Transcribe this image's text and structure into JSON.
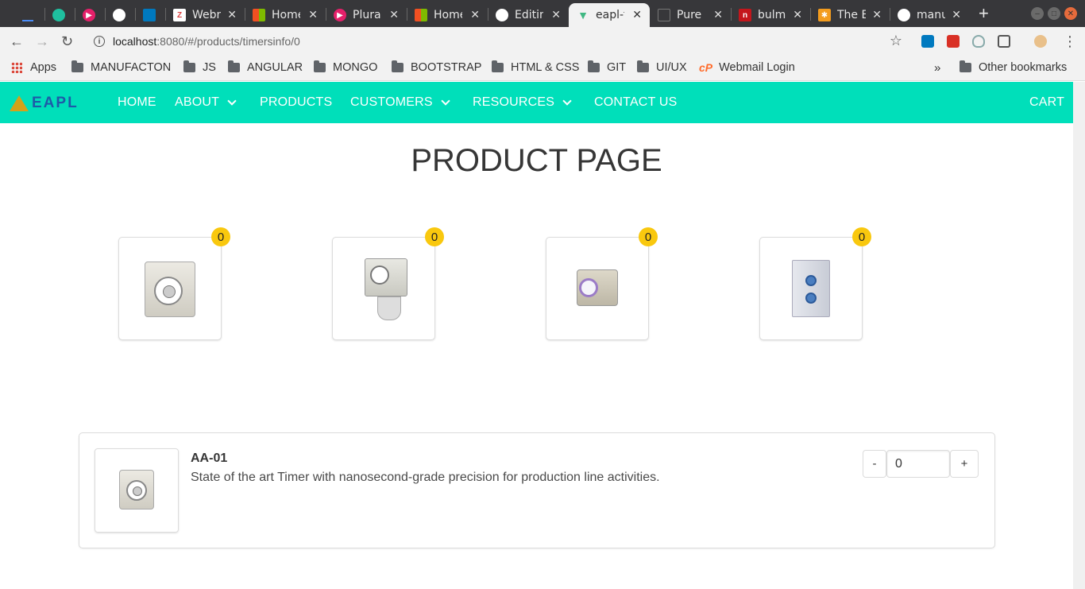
{
  "browser": {
    "tabs": [
      {
        "title": "",
        "icon": "minimized-icon",
        "active": false
      },
      {
        "title": "",
        "icon": "feather-icon",
        "active": false
      },
      {
        "title": "",
        "icon": "pluralsight-icon",
        "active": false
      },
      {
        "title": "",
        "icon": "github-icon",
        "active": false
      },
      {
        "title": "",
        "icon": "trello-icon",
        "active": false
      },
      {
        "title": "Webm",
        "icon": "webmail-icon",
        "active": false
      },
      {
        "title": "Home",
        "icon": "microsoft-icon",
        "active": false
      },
      {
        "title": "Plural",
        "icon": "pluralsight-icon",
        "active": false
      },
      {
        "title": "Home",
        "icon": "microsoft-icon",
        "active": false
      },
      {
        "title": "Editin",
        "icon": "github-icon",
        "active": false
      },
      {
        "title": "eapl-f",
        "icon": "vue-icon",
        "active": true
      },
      {
        "title": "Pure (",
        "icon": "page-icon",
        "active": false
      },
      {
        "title": "bulm",
        "icon": "bulma-icon",
        "active": false
      },
      {
        "title": "The E",
        "icon": "star-orange-icon",
        "active": false
      },
      {
        "title": "manu",
        "icon": "github-icon",
        "active": false
      }
    ],
    "url_host": "localhost",
    "url_path": ":8080/#/products/timersinfo/0",
    "bookmarks": [
      "Apps",
      "MANUFACTON",
      "JS",
      "ANGULAR",
      "MONGO",
      "BOOTSTRAP",
      "HTML & CSS",
      "GIT",
      "UI/UX",
      "Webmail Login"
    ],
    "other_bookmarks": "Other bookmarks",
    "overflow": "»"
  },
  "site": {
    "logo_text": "EAPL",
    "nav": {
      "home": "HOME",
      "about": "ABOUT",
      "products": "PRODUCTS",
      "customers": "CUSTOMERS",
      "resources": "RESOURCES",
      "contact": "CONTACT US",
      "cart": "CART"
    },
    "page_title": "PRODUCT PAGE",
    "products": [
      {
        "count": "0",
        "icon": "timer-relay-icon"
      },
      {
        "count": "0",
        "icon": "timer-relay-icon"
      },
      {
        "count": "0",
        "icon": "timer-relay-icon"
      },
      {
        "count": "0",
        "icon": "din-rail-timer-icon"
      }
    ],
    "cart_item": {
      "name": "AA-01",
      "description": "State of the art Timer with nanosecond-grade precision for production line activities.",
      "decrement": "-",
      "increment": "+",
      "quantity": "0"
    }
  },
  "colors": {
    "nav_bg": "#00dfba",
    "badge": "#f9c80e",
    "logo_blue": "#1e5aa8"
  }
}
